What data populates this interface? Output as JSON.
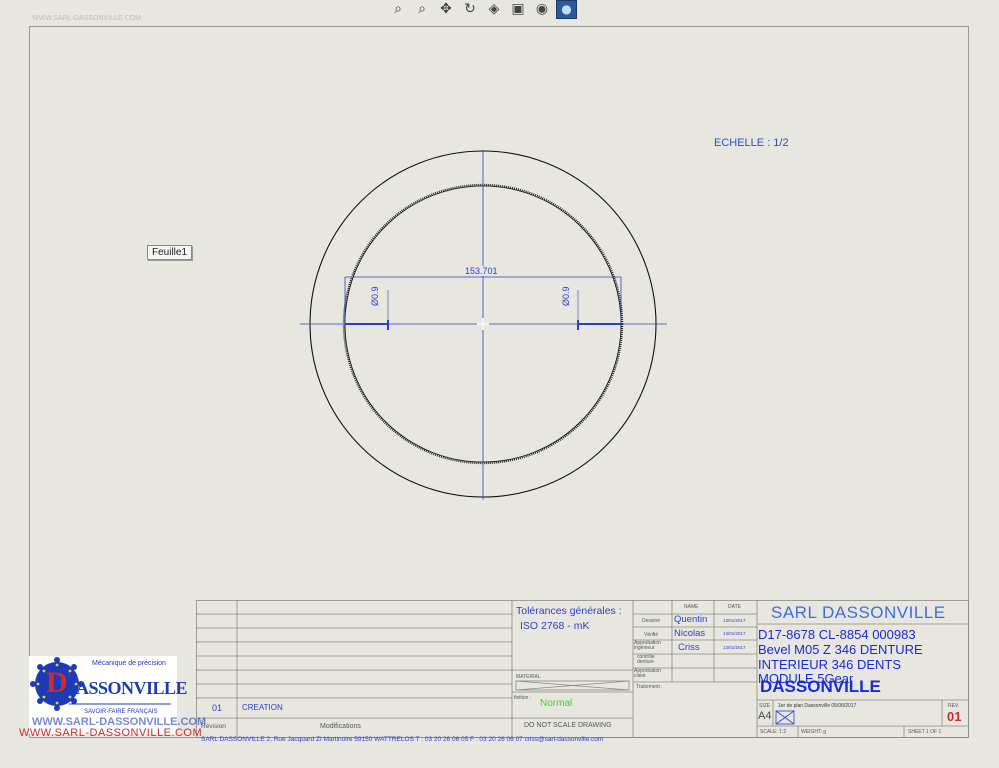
{
  "toolbar": {
    "icons": [
      "zoom-fit-icon",
      "zoom-area-icon",
      "pan-icon",
      "rotate-icon",
      "section-view-icon",
      "display-style-icon",
      "view-orientation-icon",
      "appearance-icon"
    ]
  },
  "watermark_top": "WWW.SARL-DASSONVILLE.COM",
  "sheet_tab": "Feuille1",
  "scale_note": "ECHELLE : 1/2",
  "dimensions": {
    "width": "153.701",
    "left_diam": "Ø0.9",
    "right_diam": "Ø0.9"
  },
  "title_block": {
    "tolerance_title": "Tolérances générales :",
    "tolerance_std": "ISO 2768 - mK",
    "material_label": "MATERIAL",
    "finish_label": "finition :",
    "finish_value": "Normal",
    "do_not_scale": "DO NOT SCALE DRAWING",
    "treatment_label": "Traitement :",
    "col_name": "NAME",
    "col_date": "DATE",
    "row_drawn": "Dessiné",
    "row_checked": "Vérifié",
    "row_eng_approval": "Approbation ingénieur",
    "row_teeth_check": "contrôle denture",
    "row_client_approval": "Approbation client",
    "drawn_by": "Quentin",
    "checked_by": "Nicolas",
    "approved_by": "Criss",
    "date1": "13/01/2017",
    "date2": "13/01/2017",
    "date3": "13/01/2017",
    "company": "SARL DASSONVILLE",
    "part_line1": "D17-8678 CL-8854  000983",
    "part_line2": "Bevel M05 Z 346 DENTURE",
    "part_line3": "INTERIEUR 346 DENTS",
    "part_line4": "MODULE 5Gear",
    "part_overlap": "DASSONVILLE",
    "size_label": "SIZE",
    "size_value": "A4",
    "plan_info": "1er de plan Dassonville  05/06/2017",
    "rev_label": "REV.",
    "rev_value": "01",
    "scale_label": "SCALE: 1:2",
    "weight_label": "WEIGHT: g",
    "sheet_label": "SHEET 1 OF 1",
    "revision_num": "01",
    "revision_desc": "CREATION",
    "revision_header": "Révision",
    "modifications_header": "Modifications"
  },
  "logo": {
    "tagline": "Mécanique de précision",
    "brand": "ASSONVILLE",
    "letter": "D",
    "motto": "SAVOIR-FAIRE FRANÇAIS",
    "url_logo": "WWW.SARL-DASSONVILLE.COM"
  },
  "footer_url": "WWW.SARL-DASSONVILLE.COM",
  "address": "SARL DASSONVILLE 2, Rue Jacquard ZI Martinoire 59150 WATTRELOS  T : 03 20 26 06 05 F : 03 20 26 06 07 criss@sarl-dassonville.com",
  "colors": {
    "accent": "#2a3fd0",
    "brand_red": "#d02a2a",
    "sheet_bg": "#e8e7df"
  }
}
